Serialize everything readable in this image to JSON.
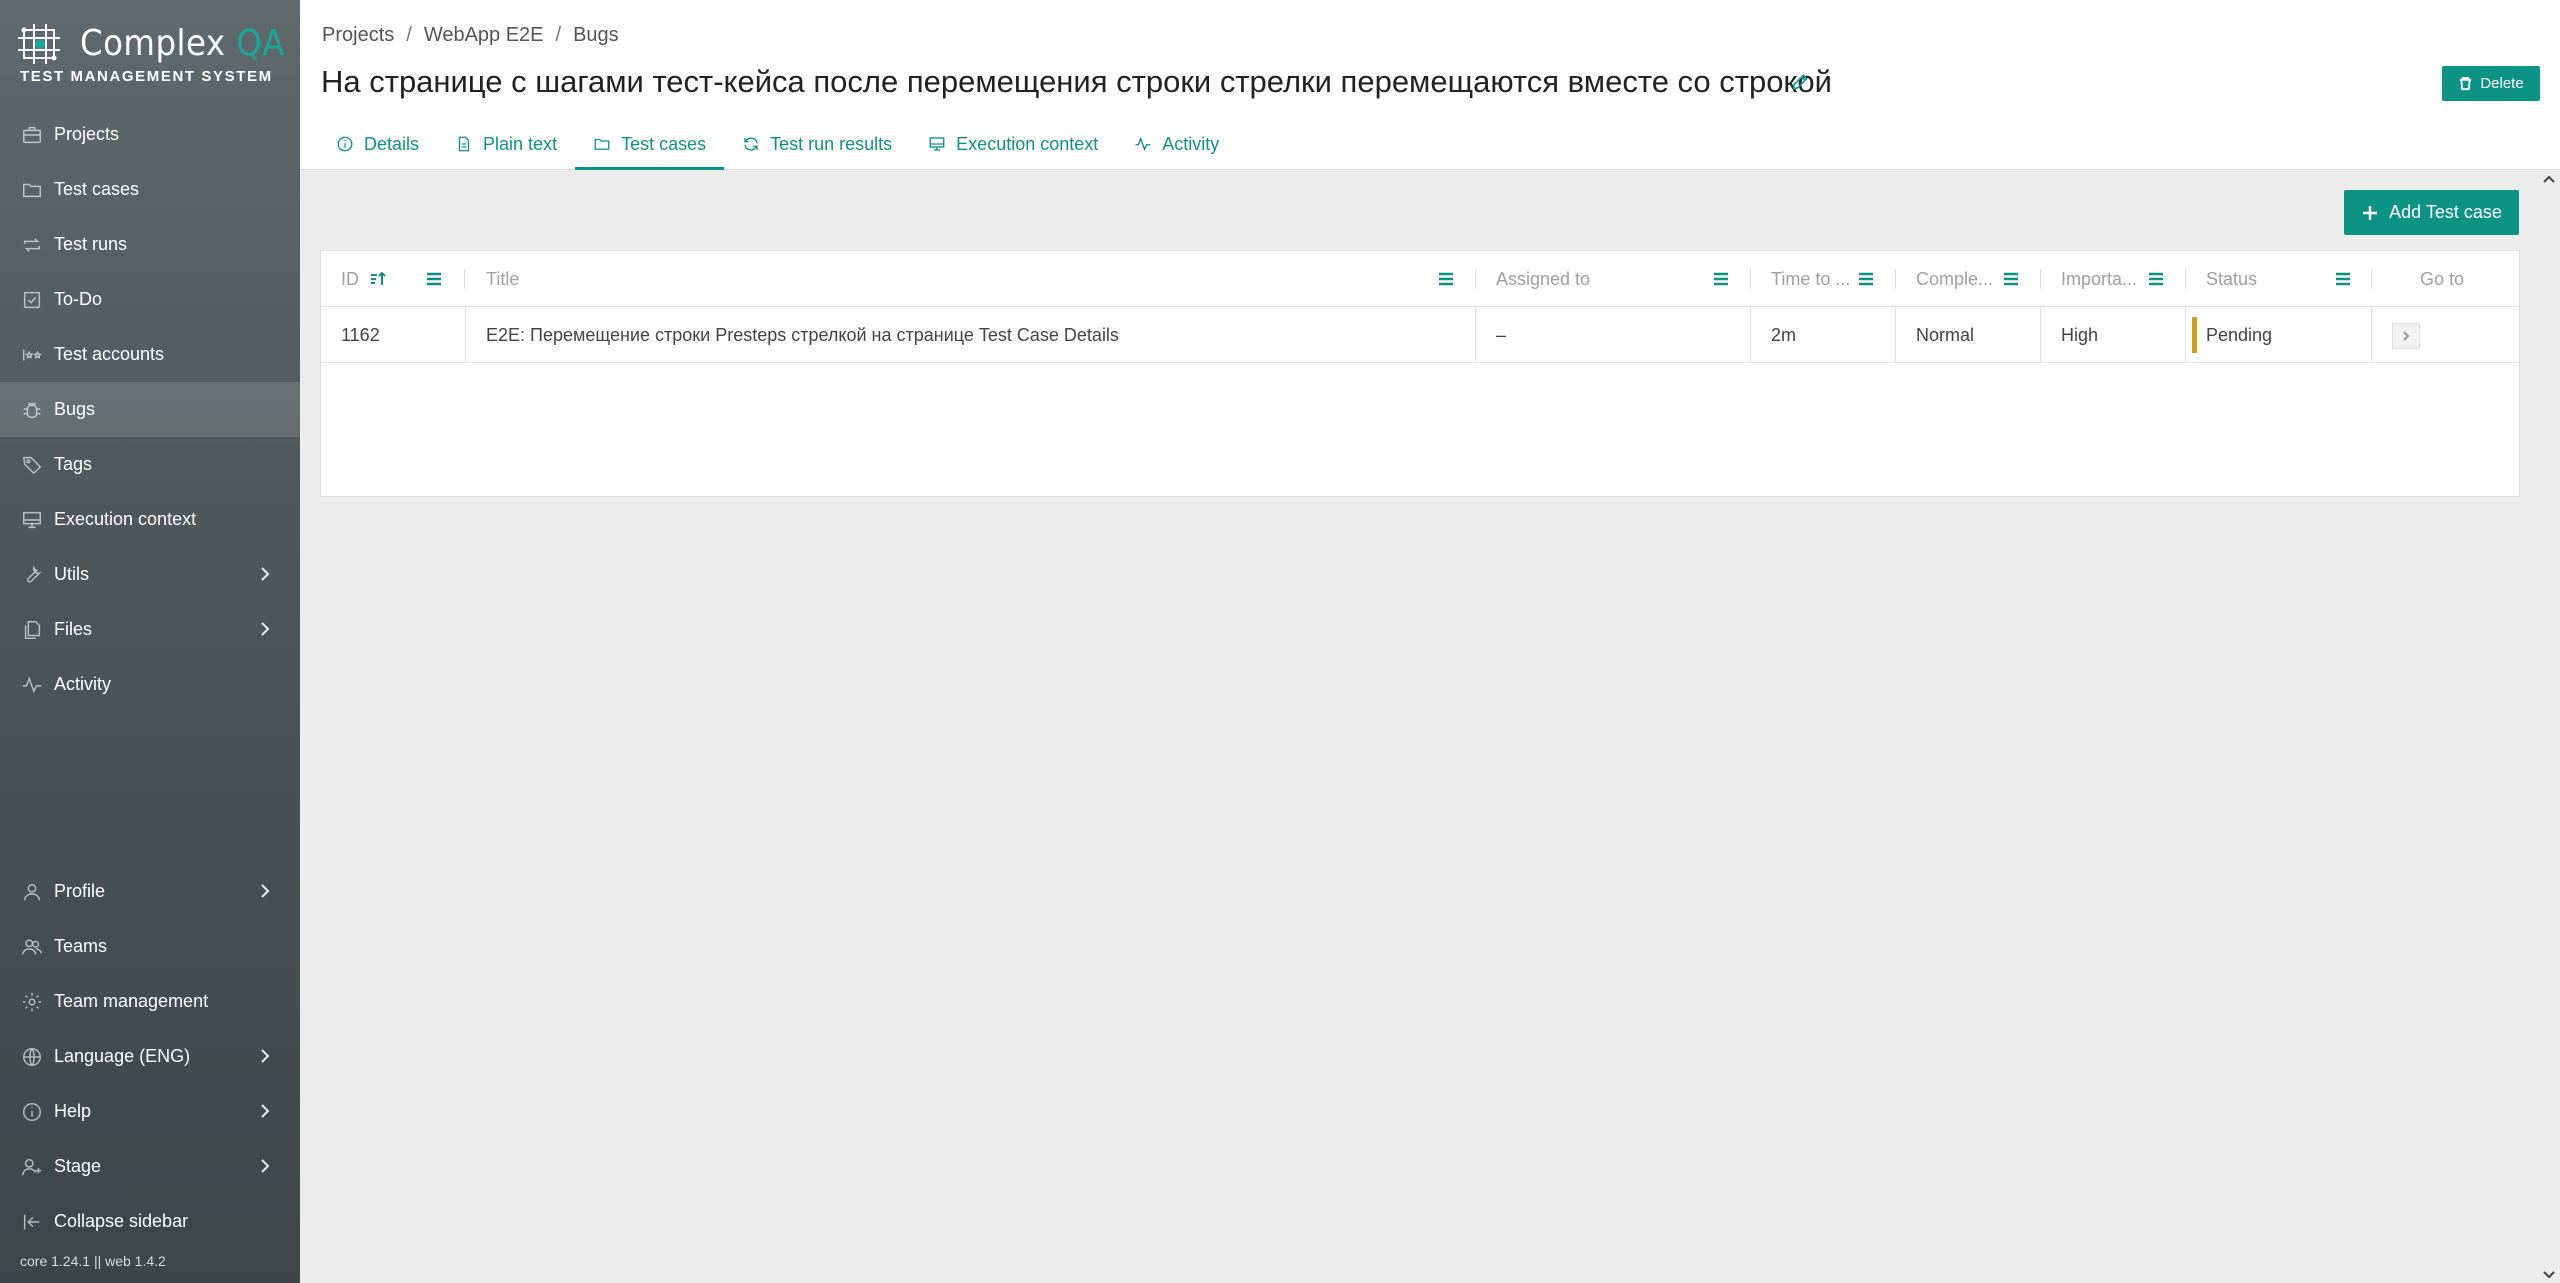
{
  "brand": {
    "title_main": "Complex",
    "title_accent": "QA",
    "subtitle": "TEST MANAGEMENT SYSTEM",
    "accent_color": "#0d9384"
  },
  "sidebar": {
    "top_items": [
      {
        "label": "Projects",
        "icon": "briefcase-icon"
      },
      {
        "label": "Test cases",
        "icon": "folder-icon"
      },
      {
        "label": "Test runs",
        "icon": "repeat-icon"
      },
      {
        "label": "To-Do",
        "icon": "checkbox-icon"
      },
      {
        "label": "Test accounts",
        "icon": "user-stars-icon"
      },
      {
        "label": "Bugs",
        "icon": "bug-icon",
        "active": true
      },
      {
        "label": "Tags",
        "icon": "tag-icon"
      },
      {
        "label": "Execution context",
        "icon": "monitor-icon"
      },
      {
        "label": "Utils",
        "icon": "wrench-icon",
        "has_submenu": true
      },
      {
        "label": "Files",
        "icon": "files-icon",
        "has_submenu": true
      },
      {
        "label": "Activity",
        "icon": "activity-icon"
      }
    ],
    "bottom_items": [
      {
        "label": "Profile",
        "icon": "user-icon",
        "has_submenu": true
      },
      {
        "label": "Teams",
        "icon": "users-icon"
      },
      {
        "label": "Team management",
        "icon": "gear-icon"
      },
      {
        "label": "Language (ENG)",
        "icon": "globe-icon",
        "has_submenu": true
      },
      {
        "label": "Help",
        "icon": "info-icon",
        "has_submenu": true
      },
      {
        "label": "Stage",
        "icon": "user-plus-icon",
        "has_submenu": true
      },
      {
        "label": "Collapse sidebar",
        "icon": "collapse-icon"
      }
    ],
    "version": "core 1.24.1 || web 1.4.2"
  },
  "breadcrumb": [
    "Projects",
    "WebApp E2E",
    "Bugs"
  ],
  "page": {
    "title": "На странице с шагами тест-кейса после перемещения строки стрелки перемещаются вместе со строкой",
    "delete_label": "Delete"
  },
  "tabs": [
    {
      "label": "Details",
      "icon": "info-icon"
    },
    {
      "label": "Plain text",
      "icon": "document-icon"
    },
    {
      "label": "Test cases",
      "icon": "folder-icon",
      "active": true
    },
    {
      "label": "Test run results",
      "icon": "refresh-icon"
    },
    {
      "label": "Execution context",
      "icon": "monitor-icon"
    },
    {
      "label": "Activity",
      "icon": "activity-icon"
    }
  ],
  "toolbar": {
    "add_label": "Add Test case"
  },
  "table": {
    "columns": [
      "ID",
      "Title",
      "Assigned to",
      "Time to ...",
      "Comple...",
      "Importa...",
      "Status",
      "Go to"
    ],
    "rows": [
      {
        "id": "1162",
        "title": "E2E: Перемещение строки Presteps стрелкой на странице Test Case Details",
        "assigned_to": "–",
        "time": "2m",
        "complexity": "Normal",
        "importance": "High",
        "status": "Pending",
        "status_color": "#c9a227"
      }
    ]
  }
}
